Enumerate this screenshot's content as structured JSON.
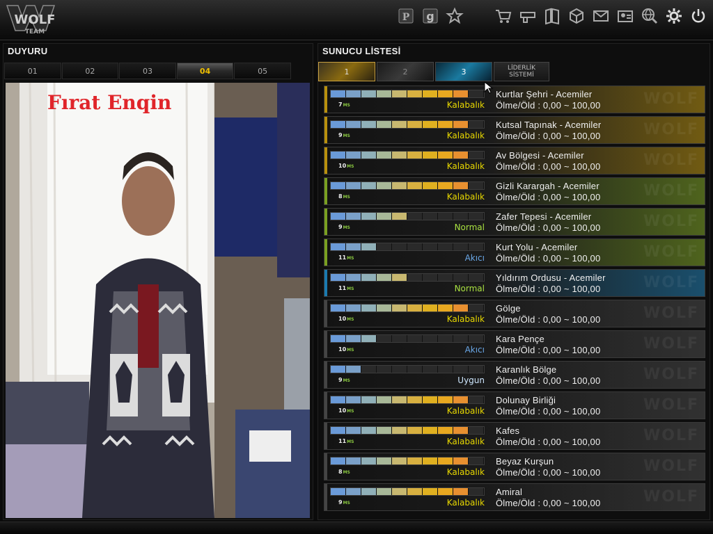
{
  "topbar": {
    "logo": {
      "line1": "WOLF",
      "line2": "TEAM"
    },
    "icons_left": [
      "wolf-points-icon",
      "g-cash-icon",
      "star-icon"
    ],
    "icons_right": [
      "cart-icon",
      "inventory-gun-icon",
      "map-book-icon",
      "box-icon",
      "mail-icon",
      "profile-card-icon",
      "globe-search-icon",
      "settings-gear-icon",
      "power-icon"
    ]
  },
  "announcement": {
    "title": "DUYURU",
    "tabs": [
      "01",
      "02",
      "03",
      "04",
      "05"
    ],
    "active_tab": "04",
    "photo_caption": "Fırat Enqin"
  },
  "server_list": {
    "title": "SUNUCU LİSTESİ",
    "tabs": [
      {
        "label": "1",
        "style": "gold"
      },
      {
        "label": "2",
        "style": "gray"
      },
      {
        "label": "3",
        "style": "blue"
      },
      {
        "label": "LİDERLİK SİSTEMİ",
        "style": "dark"
      }
    ],
    "ms_unit": "MS",
    "watermark": "WOLF",
    "servers": [
      {
        "name": "Kurtlar Şehri - Acemiler",
        "ratio": "Ölme/Öld : 0,00 ~ 100,00",
        "ping": "7",
        "status": "Kalabalık",
        "load": 0.9,
        "color": "#b8900c"
      },
      {
        "name": "Kutsal Tapınak - Acemiler",
        "ratio": "Ölme/Öld : 0,00 ~ 100,00",
        "ping": "9",
        "status": "Kalabalık",
        "load": 0.9,
        "color": "#b8900c"
      },
      {
        "name": "Av Bölgesi - Acemiler",
        "ratio": "Ölme/Öld : 0,00 ~ 100,00",
        "ping": "10",
        "status": "Kalabalık",
        "load": 0.9,
        "color": "#b8900c"
      },
      {
        "name": "Gizli Karargah - Acemiler",
        "ratio": "Ölme/Öld : 0,00 ~ 100,00",
        "ping": "8",
        "status": "Kalabalık",
        "load": 0.9,
        "color": "#7aa020"
      },
      {
        "name": "Zafer Tepesi - Acemiler",
        "ratio": "Ölme/Öld : 0,00 ~ 100,00",
        "ping": "9",
        "status": "Normal",
        "load": 0.5,
        "color": "#7aa020"
      },
      {
        "name": "Kurt Yolu - Acemiler",
        "ratio": "Ölme/Öld : 0,00 ~ 100,00",
        "ping": "11",
        "status": "Akıcı",
        "load": 0.3,
        "color": "#7aa020"
      },
      {
        "name": "Yıldırım Ordusu - Acemiler",
        "ratio": "Ölme/Öld : 0,00 ~ 100,00",
        "ping": "11",
        "status": "Normal",
        "load": 0.5,
        "color": "#1a7ab0"
      },
      {
        "name": "Gölge",
        "ratio": "Ölme/Öld : 0,00 ~ 100,00",
        "ping": "10",
        "status": "Kalabalık",
        "load": 0.9,
        "color": "#444444"
      },
      {
        "name": "Kara Pençe",
        "ratio": "Ölme/Öld : 0,00 ~ 100,00",
        "ping": "10",
        "status": "Akıcı",
        "load": 0.3,
        "color": "#444444"
      },
      {
        "name": "Karanlık Bölge",
        "ratio": "Ölme/Öld : 0,00 ~ 100,00",
        "ping": "9",
        "status": "Uygun",
        "load": 0.2,
        "color": "#444444"
      },
      {
        "name": "Dolunay Birliği",
        "ratio": "Ölme/Öld : 0,00 ~ 100,00",
        "ping": "10",
        "status": "Kalabalık",
        "load": 0.9,
        "color": "#444444"
      },
      {
        "name": "Kafes",
        "ratio": "Ölme/Öld : 0,00 ~ 100,00",
        "ping": "11",
        "status": "Kalabalık",
        "load": 0.9,
        "color": "#444444"
      },
      {
        "name": "Beyaz Kurşun",
        "ratio": "Ölme/Öld : 0,00 ~ 100,00",
        "ping": "8",
        "status": "Kalabalık",
        "load": 0.9,
        "color": "#444444"
      },
      {
        "name": "Amiral",
        "ratio": "Ölme/Öld : 0,00 ~ 100,00",
        "ping": "9",
        "status": "Kalabalık",
        "load": 0.9,
        "color": "#444444"
      }
    ],
    "status_colors": {
      "Kalabalık": "#e8d800",
      "Normal": "#a8e040",
      "Akıcı": "#6aa8e8",
      "Uygun": "#cfe8ff"
    },
    "segment_colors": [
      "#6a9ad8",
      "#7aa0c8",
      "#90b0b8",
      "#a8b898",
      "#c8b870",
      "#d8b040",
      "#e0b020",
      "#e8a820",
      "#e89030",
      "#e07838"
    ]
  }
}
